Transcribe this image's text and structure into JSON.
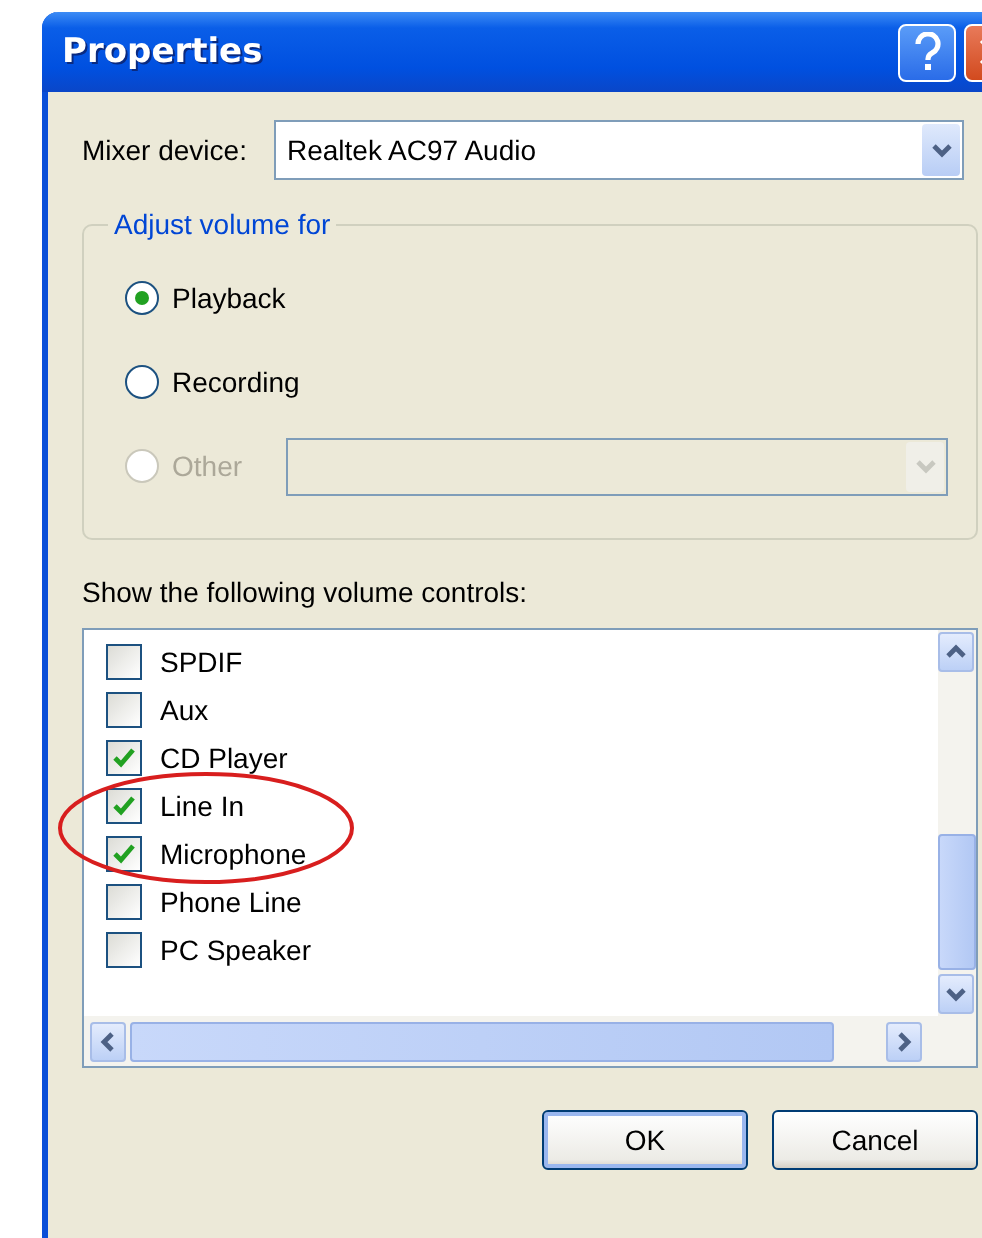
{
  "window": {
    "title": "Properties"
  },
  "mixer_device": {
    "label": "Mixer device:",
    "value": "Realtek AC97 Audio"
  },
  "adjust_volume": {
    "legend": "Adjust volume for",
    "options": [
      {
        "label": "Playback",
        "selected": true,
        "disabled": false,
        "kind": "plain"
      },
      {
        "label": "Recording",
        "selected": false,
        "disabled": false,
        "kind": "plain"
      },
      {
        "label": "Other",
        "selected": false,
        "disabled": true,
        "kind": "dropdown"
      }
    ]
  },
  "volume_controls": {
    "label": "Show the following volume controls:",
    "items": [
      {
        "label": "SPDIF",
        "checked": false
      },
      {
        "label": "Aux",
        "checked": false
      },
      {
        "label": "CD Player",
        "checked": true
      },
      {
        "label": "Line In",
        "checked": true
      },
      {
        "label": "Microphone",
        "checked": true
      },
      {
        "label": "Phone Line",
        "checked": false
      },
      {
        "label": "PC Speaker",
        "checked": false
      }
    ]
  },
  "buttons": [
    {
      "label": "OK",
      "default": true
    },
    {
      "label": "Cancel",
      "default": false
    }
  ]
}
